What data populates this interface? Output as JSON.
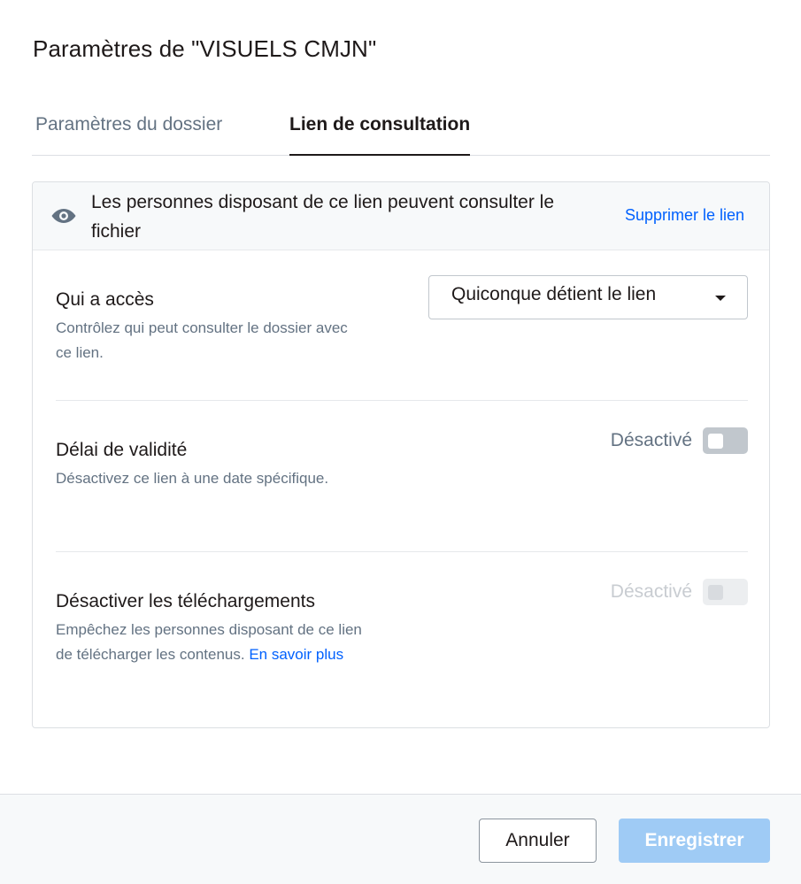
{
  "dialog": {
    "title": "Paramètres de \"VISUELS CMJN\""
  },
  "tabs": [
    {
      "label": "Paramètres du dossier",
      "active": false
    },
    {
      "label": "Lien de consultation",
      "active": true
    }
  ],
  "banner": {
    "icon": "eye-icon",
    "text": "Les personnes disposant de ce lien peuvent consulter le fichier",
    "remove_link": "Supprimer le lien"
  },
  "access": {
    "title": "Qui a accès",
    "description": "Contrôlez qui peut consulter le dossier avec ce lien.",
    "select_value": "Quiconque détient le lien"
  },
  "expiry": {
    "title": "Délai de validité",
    "description": "Désactivez ce lien à une date spécifique.",
    "toggle_label": "Désactivé",
    "enabled": false
  },
  "downloads": {
    "title": "Désactiver les téléchargements",
    "description": "Empêchez les personnes disposant de ce lien de télécharger les contenus.",
    "learn_more": "En savoir plus",
    "toggle_label": "Désactivé",
    "enabled": false,
    "toggle_disabled": true
  },
  "footer": {
    "cancel_label": "Annuler",
    "save_label": "Enregistrer"
  },
  "colors": {
    "link": "#0061fe",
    "save_button_disabled": "#9fcbf5",
    "muted_text": "#637282"
  }
}
